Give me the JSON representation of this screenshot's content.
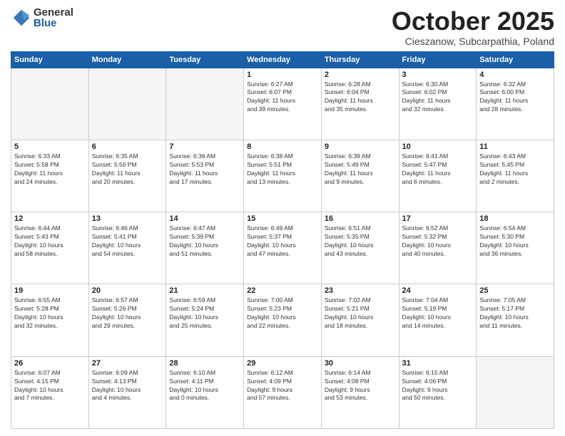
{
  "header": {
    "logo": {
      "general": "General",
      "blue": "Blue"
    },
    "title": "October 2025",
    "subtitle": "Cieszanow, Subcarpathia, Poland"
  },
  "weekdays": [
    "Sunday",
    "Monday",
    "Tuesday",
    "Wednesday",
    "Thursday",
    "Friday",
    "Saturday"
  ],
  "weeks": [
    [
      {
        "day": "",
        "info": ""
      },
      {
        "day": "",
        "info": ""
      },
      {
        "day": "",
        "info": ""
      },
      {
        "day": "1",
        "info": "Sunrise: 6:27 AM\nSunset: 6:07 PM\nDaylight: 11 hours\nand 39 minutes."
      },
      {
        "day": "2",
        "info": "Sunrise: 6:28 AM\nSunset: 6:04 PM\nDaylight: 11 hours\nand 35 minutes."
      },
      {
        "day": "3",
        "info": "Sunrise: 6:30 AM\nSunset: 6:02 PM\nDaylight: 11 hours\nand 32 minutes."
      },
      {
        "day": "4",
        "info": "Sunrise: 6:32 AM\nSunset: 6:00 PM\nDaylight: 11 hours\nand 28 minutes."
      }
    ],
    [
      {
        "day": "5",
        "info": "Sunrise: 6:33 AM\nSunset: 5:58 PM\nDaylight: 11 hours\nand 24 minutes."
      },
      {
        "day": "6",
        "info": "Sunrise: 6:35 AM\nSunset: 5:56 PM\nDaylight: 11 hours\nand 20 minutes."
      },
      {
        "day": "7",
        "info": "Sunrise: 6:36 AM\nSunset: 5:53 PM\nDaylight: 11 hours\nand 17 minutes."
      },
      {
        "day": "8",
        "info": "Sunrise: 6:38 AM\nSunset: 5:51 PM\nDaylight: 11 hours\nand 13 minutes."
      },
      {
        "day": "9",
        "info": "Sunrise: 6:39 AM\nSunset: 5:49 PM\nDaylight: 11 hours\nand 9 minutes."
      },
      {
        "day": "10",
        "info": "Sunrise: 6:41 AM\nSunset: 5:47 PM\nDaylight: 11 hours\nand 6 minutes."
      },
      {
        "day": "11",
        "info": "Sunrise: 6:43 AM\nSunset: 5:45 PM\nDaylight: 11 hours\nand 2 minutes."
      }
    ],
    [
      {
        "day": "12",
        "info": "Sunrise: 6:44 AM\nSunset: 5:43 PM\nDaylight: 10 hours\nand 58 minutes."
      },
      {
        "day": "13",
        "info": "Sunrise: 6:46 AM\nSunset: 5:41 PM\nDaylight: 10 hours\nand 54 minutes."
      },
      {
        "day": "14",
        "info": "Sunrise: 6:47 AM\nSunset: 5:39 PM\nDaylight: 10 hours\nand 51 minutes."
      },
      {
        "day": "15",
        "info": "Sunrise: 6:49 AM\nSunset: 5:37 PM\nDaylight: 10 hours\nand 47 minutes."
      },
      {
        "day": "16",
        "info": "Sunrise: 6:51 AM\nSunset: 5:35 PM\nDaylight: 10 hours\nand 43 minutes."
      },
      {
        "day": "17",
        "info": "Sunrise: 6:52 AM\nSunset: 5:32 PM\nDaylight: 10 hours\nand 40 minutes."
      },
      {
        "day": "18",
        "info": "Sunrise: 6:54 AM\nSunset: 5:30 PM\nDaylight: 10 hours\nand 36 minutes."
      }
    ],
    [
      {
        "day": "19",
        "info": "Sunrise: 6:55 AM\nSunset: 5:28 PM\nDaylight: 10 hours\nand 32 minutes."
      },
      {
        "day": "20",
        "info": "Sunrise: 6:57 AM\nSunset: 5:26 PM\nDaylight: 10 hours\nand 29 minutes."
      },
      {
        "day": "21",
        "info": "Sunrise: 6:59 AM\nSunset: 5:24 PM\nDaylight: 10 hours\nand 25 minutes."
      },
      {
        "day": "22",
        "info": "Sunrise: 7:00 AM\nSunset: 5:23 PM\nDaylight: 10 hours\nand 22 minutes."
      },
      {
        "day": "23",
        "info": "Sunrise: 7:02 AM\nSunset: 5:21 PM\nDaylight: 10 hours\nand 18 minutes."
      },
      {
        "day": "24",
        "info": "Sunrise: 7:04 AM\nSunset: 5:19 PM\nDaylight: 10 hours\nand 14 minutes."
      },
      {
        "day": "25",
        "info": "Sunrise: 7:05 AM\nSunset: 5:17 PM\nDaylight: 10 hours\nand 11 minutes."
      }
    ],
    [
      {
        "day": "26",
        "info": "Sunrise: 6:07 AM\nSunset: 4:15 PM\nDaylight: 10 hours\nand 7 minutes."
      },
      {
        "day": "27",
        "info": "Sunrise: 6:09 AM\nSunset: 4:13 PM\nDaylight: 10 hours\nand 4 minutes."
      },
      {
        "day": "28",
        "info": "Sunrise: 6:10 AM\nSunset: 4:11 PM\nDaylight: 10 hours\nand 0 minutes."
      },
      {
        "day": "29",
        "info": "Sunrise: 6:12 AM\nSunset: 4:09 PM\nDaylight: 9 hours\nand 57 minutes."
      },
      {
        "day": "30",
        "info": "Sunrise: 6:14 AM\nSunset: 4:08 PM\nDaylight: 9 hours\nand 53 minutes."
      },
      {
        "day": "31",
        "info": "Sunrise: 6:15 AM\nSunset: 4:06 PM\nDaylight: 9 hours\nand 50 minutes."
      },
      {
        "day": "",
        "info": ""
      }
    ]
  ]
}
